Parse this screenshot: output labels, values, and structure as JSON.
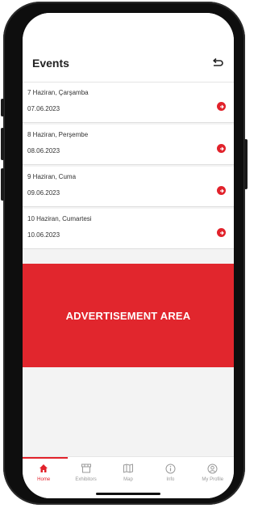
{
  "header": {
    "title": "Events"
  },
  "events": [
    {
      "day": "7 Haziran, Çarşamba",
      "date": "07.06.2023"
    },
    {
      "day": "8 Haziran, Perşembe",
      "date": "08.06.2023"
    },
    {
      "day": "9 Haziran, Cuma",
      "date": "09.06.2023"
    },
    {
      "day": "10 Haziran, Cumartesi",
      "date": "10.06.2023"
    }
  ],
  "ad": {
    "label": "ADVERTISEMENT AREA"
  },
  "tabs": [
    {
      "label": "Home",
      "icon": "home-icon",
      "active": true
    },
    {
      "label": "Exhibitors",
      "icon": "store-icon",
      "active": false
    },
    {
      "label": "Map",
      "icon": "map-icon",
      "active": false
    },
    {
      "label": "Info",
      "icon": "info-icon",
      "active": false
    },
    {
      "label": "My Profile",
      "icon": "profile-icon",
      "active": false
    }
  ],
  "colors": {
    "accent": "#e1222b",
    "ad_background": "#e1262d"
  }
}
